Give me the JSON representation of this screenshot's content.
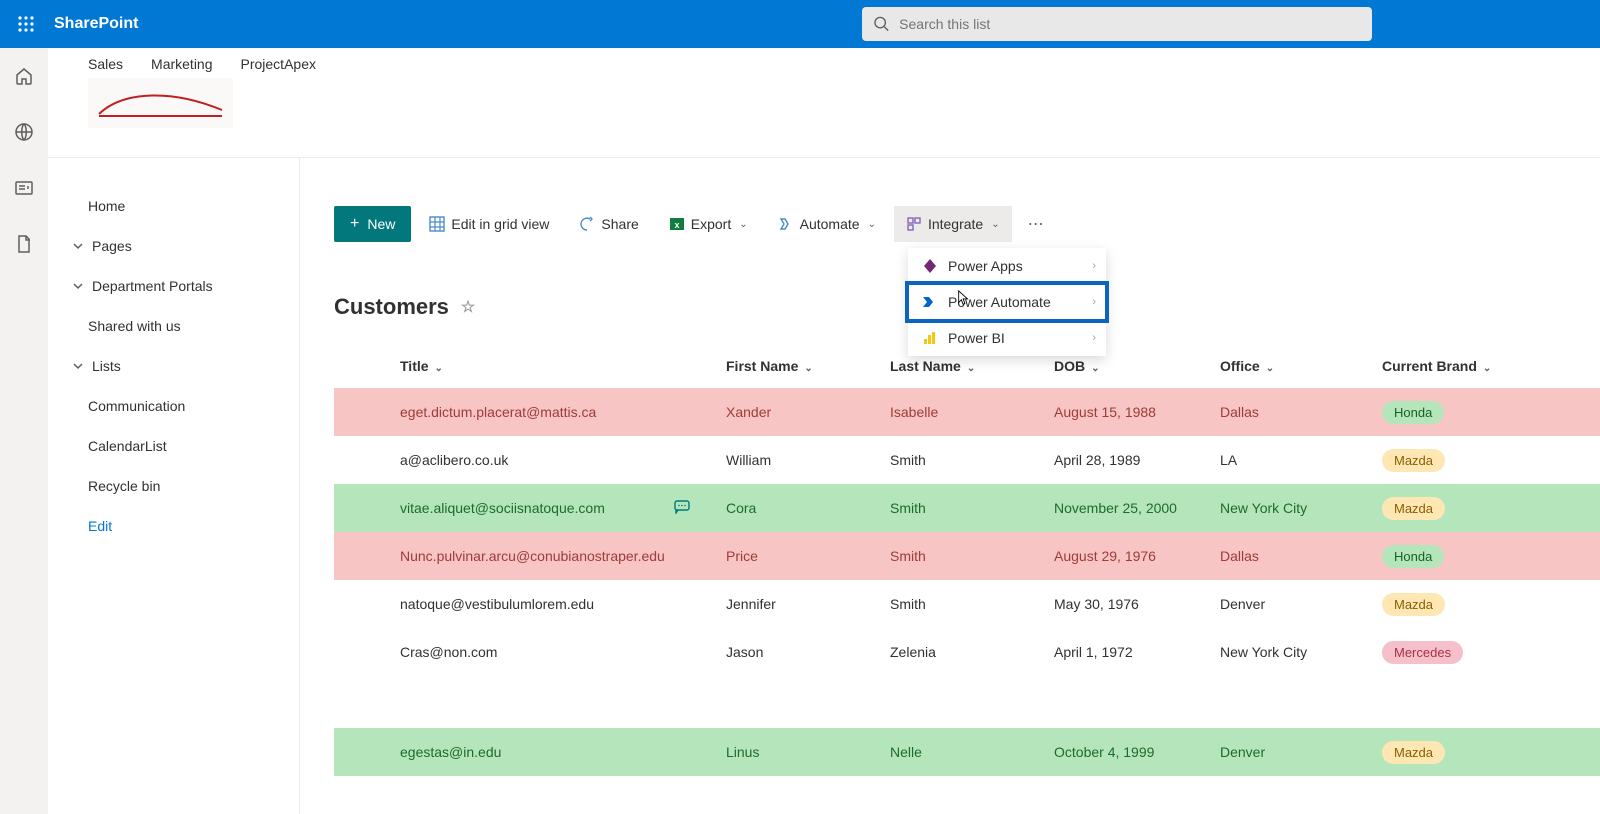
{
  "brand": "SharePoint",
  "search": {
    "placeholder": "Search this list"
  },
  "hubnav": [
    "Sales",
    "Marketing",
    "ProjectApex"
  ],
  "leftnav": {
    "home": "Home",
    "pages": "Pages",
    "dept": "Department Portals",
    "shared": "Shared with us",
    "lists": "Lists",
    "comm": "Communication",
    "cal": "CalendarList",
    "recycle": "Recycle bin",
    "edit": "Edit"
  },
  "commands": {
    "new": "New",
    "grid": "Edit in grid view",
    "share": "Share",
    "export": "Export",
    "automate": "Automate",
    "integrate": "Integrate"
  },
  "dropdown": {
    "powerapps": "Power Apps",
    "powerautomate": "Power Automate",
    "powerbi": "Power BI"
  },
  "list": {
    "title": "Customers"
  },
  "columns": {
    "title": "Title",
    "firstname": "First Name",
    "lastname": "Last Name",
    "dob": "DOB",
    "office": "Office",
    "brand": "Current Brand"
  },
  "rows": [
    {
      "title": "eget.dictum.placerat@mattis.ca",
      "fn": "Xander",
      "ln": "Isabelle",
      "dob": "August 15, 1988",
      "office": "Dallas",
      "brand": "Honda",
      "brandClass": "b-honda",
      "rowClass": "pink",
      "comment": false
    },
    {
      "title": "a@aclibero.co.uk",
      "fn": "William",
      "ln": "Smith",
      "dob": "April 28, 1989",
      "office": "LA",
      "brand": "Mazda",
      "brandClass": "b-mazda",
      "rowClass": "",
      "comment": false
    },
    {
      "title": "vitae.aliquet@sociisnatoque.com",
      "fn": "Cora",
      "ln": "Smith",
      "dob": "November 25, 2000",
      "office": "New York City",
      "brand": "Mazda",
      "brandClass": "b-mazda",
      "rowClass": "green",
      "comment": true
    },
    {
      "title": "Nunc.pulvinar.arcu@conubianostraper.edu",
      "fn": "Price",
      "ln": "Smith",
      "dob": "August 29, 1976",
      "office": "Dallas",
      "brand": "Honda",
      "brandClass": "b-honda",
      "rowClass": "pink",
      "comment": false
    },
    {
      "title": "natoque@vestibulumlorem.edu",
      "fn": "Jennifer",
      "ln": "Smith",
      "dob": "May 30, 1976",
      "office": "Denver",
      "brand": "Mazda",
      "brandClass": "b-mazda",
      "rowClass": "",
      "comment": false
    },
    {
      "title": "Cras@non.com",
      "fn": "Jason",
      "ln": "Zelenia",
      "dob": "April 1, 1972",
      "office": "New York City",
      "brand": "Mercedes",
      "brandClass": "b-mercedes",
      "rowClass": "",
      "comment": false
    }
  ],
  "lastRow": {
    "title": "egestas@in.edu",
    "fn": "Linus",
    "ln": "Nelle",
    "dob": "October 4, 1999",
    "office": "Denver",
    "brand": "Mazda",
    "brandClass": "b-mazda",
    "rowClass": "green"
  }
}
